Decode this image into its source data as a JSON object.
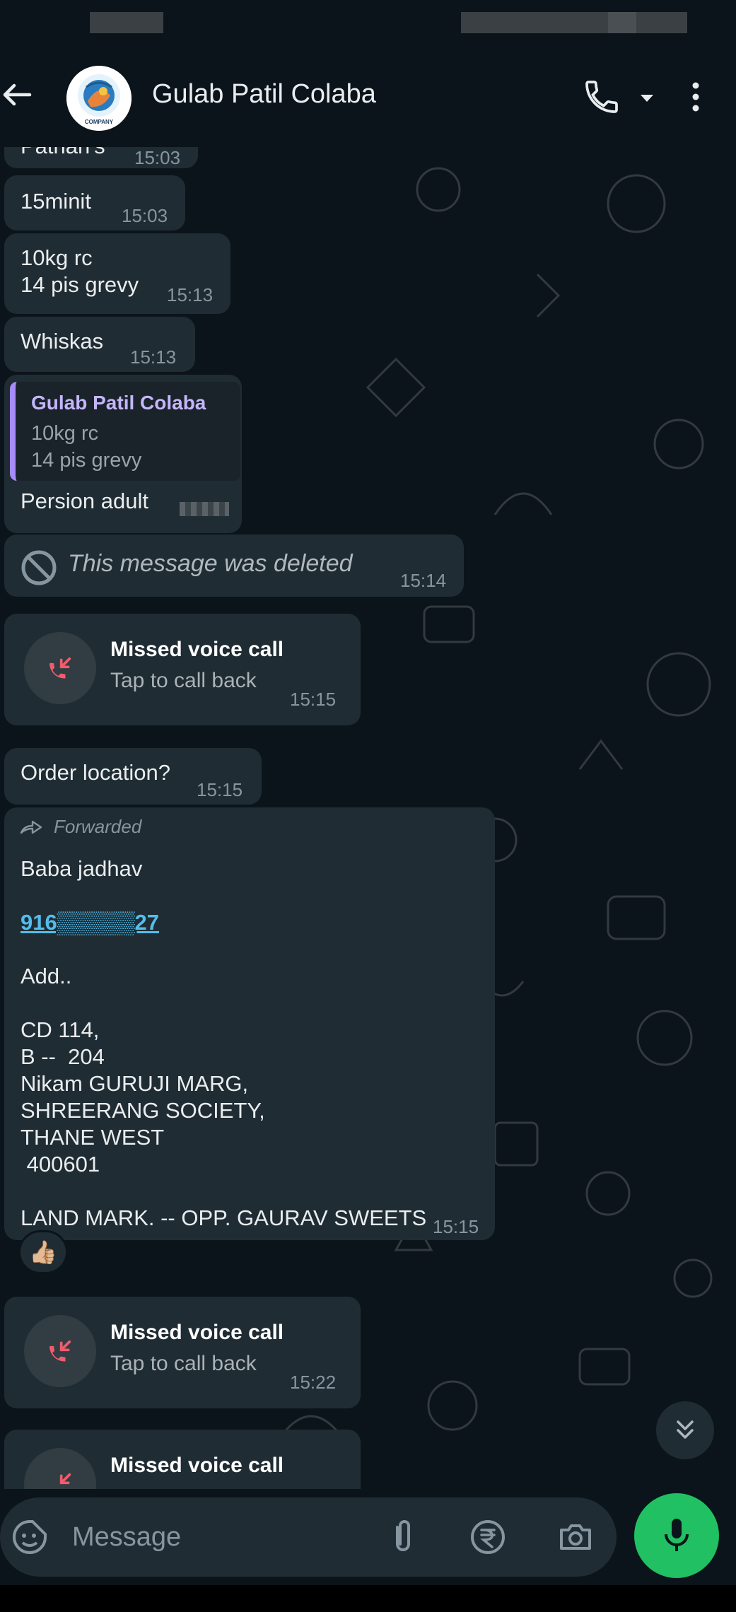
{
  "header": {
    "contact_name": "Gulab Patil Colaba",
    "avatar_label": "COMPANY"
  },
  "messages": [
    {
      "text": "Pathan's",
      "time": "15:03"
    },
    {
      "text": "15minit",
      "time": "15:03"
    },
    {
      "text": "10kg rc\n14 pis grevy",
      "time": "15:13"
    },
    {
      "text": "Whiskas",
      "time": "15:13"
    },
    {
      "reply_name": "Gulab Patil Colaba",
      "reply_text": "10kg rc\n14 pis grevy",
      "text": "Persion adult"
    },
    {
      "text": "This message was deleted",
      "time": "15:14"
    },
    {
      "title": "Missed voice call",
      "subtitle": "Tap to call back",
      "time": "15:15"
    },
    {
      "text": "Order location?",
      "time": "15:15"
    },
    {
      "forwarded_label": "Forwarded",
      "name": "Baba jadhav",
      "phone": "916▒▒▒▒▒27",
      "body": "Add..\n\nCD 114,\nB --  204\nNikam GURUJI MARG,\nSHREERANG SOCIETY,\nTHANE WEST\n 400601\n\nLAND MARK. -- OPP. GAURAV SWEETS",
      "time": "15:15",
      "reaction": "👍🏼"
    },
    {
      "title": "Missed voice call",
      "subtitle": "Tap to call back",
      "time": "15:22"
    },
    {
      "title": "Missed voice call"
    }
  ],
  "composer": {
    "placeholder": "Message"
  },
  "colors": {
    "background": "#0b141a",
    "bubble": "#202c33",
    "accent_green": "#21c063",
    "missed_call_red": "#f15c6d",
    "link_blue": "#53bdeb",
    "reply_bar": "#a78bfa"
  },
  "icons": [
    "back-arrow-icon",
    "phone-icon",
    "dropdown-icon",
    "more-vert-icon",
    "blocked-icon",
    "missed-call-icon",
    "forward-icon",
    "chevrons-down-icon",
    "sticker-icon",
    "paperclip-icon",
    "rupee-icon",
    "camera-icon",
    "mic-icon"
  ]
}
